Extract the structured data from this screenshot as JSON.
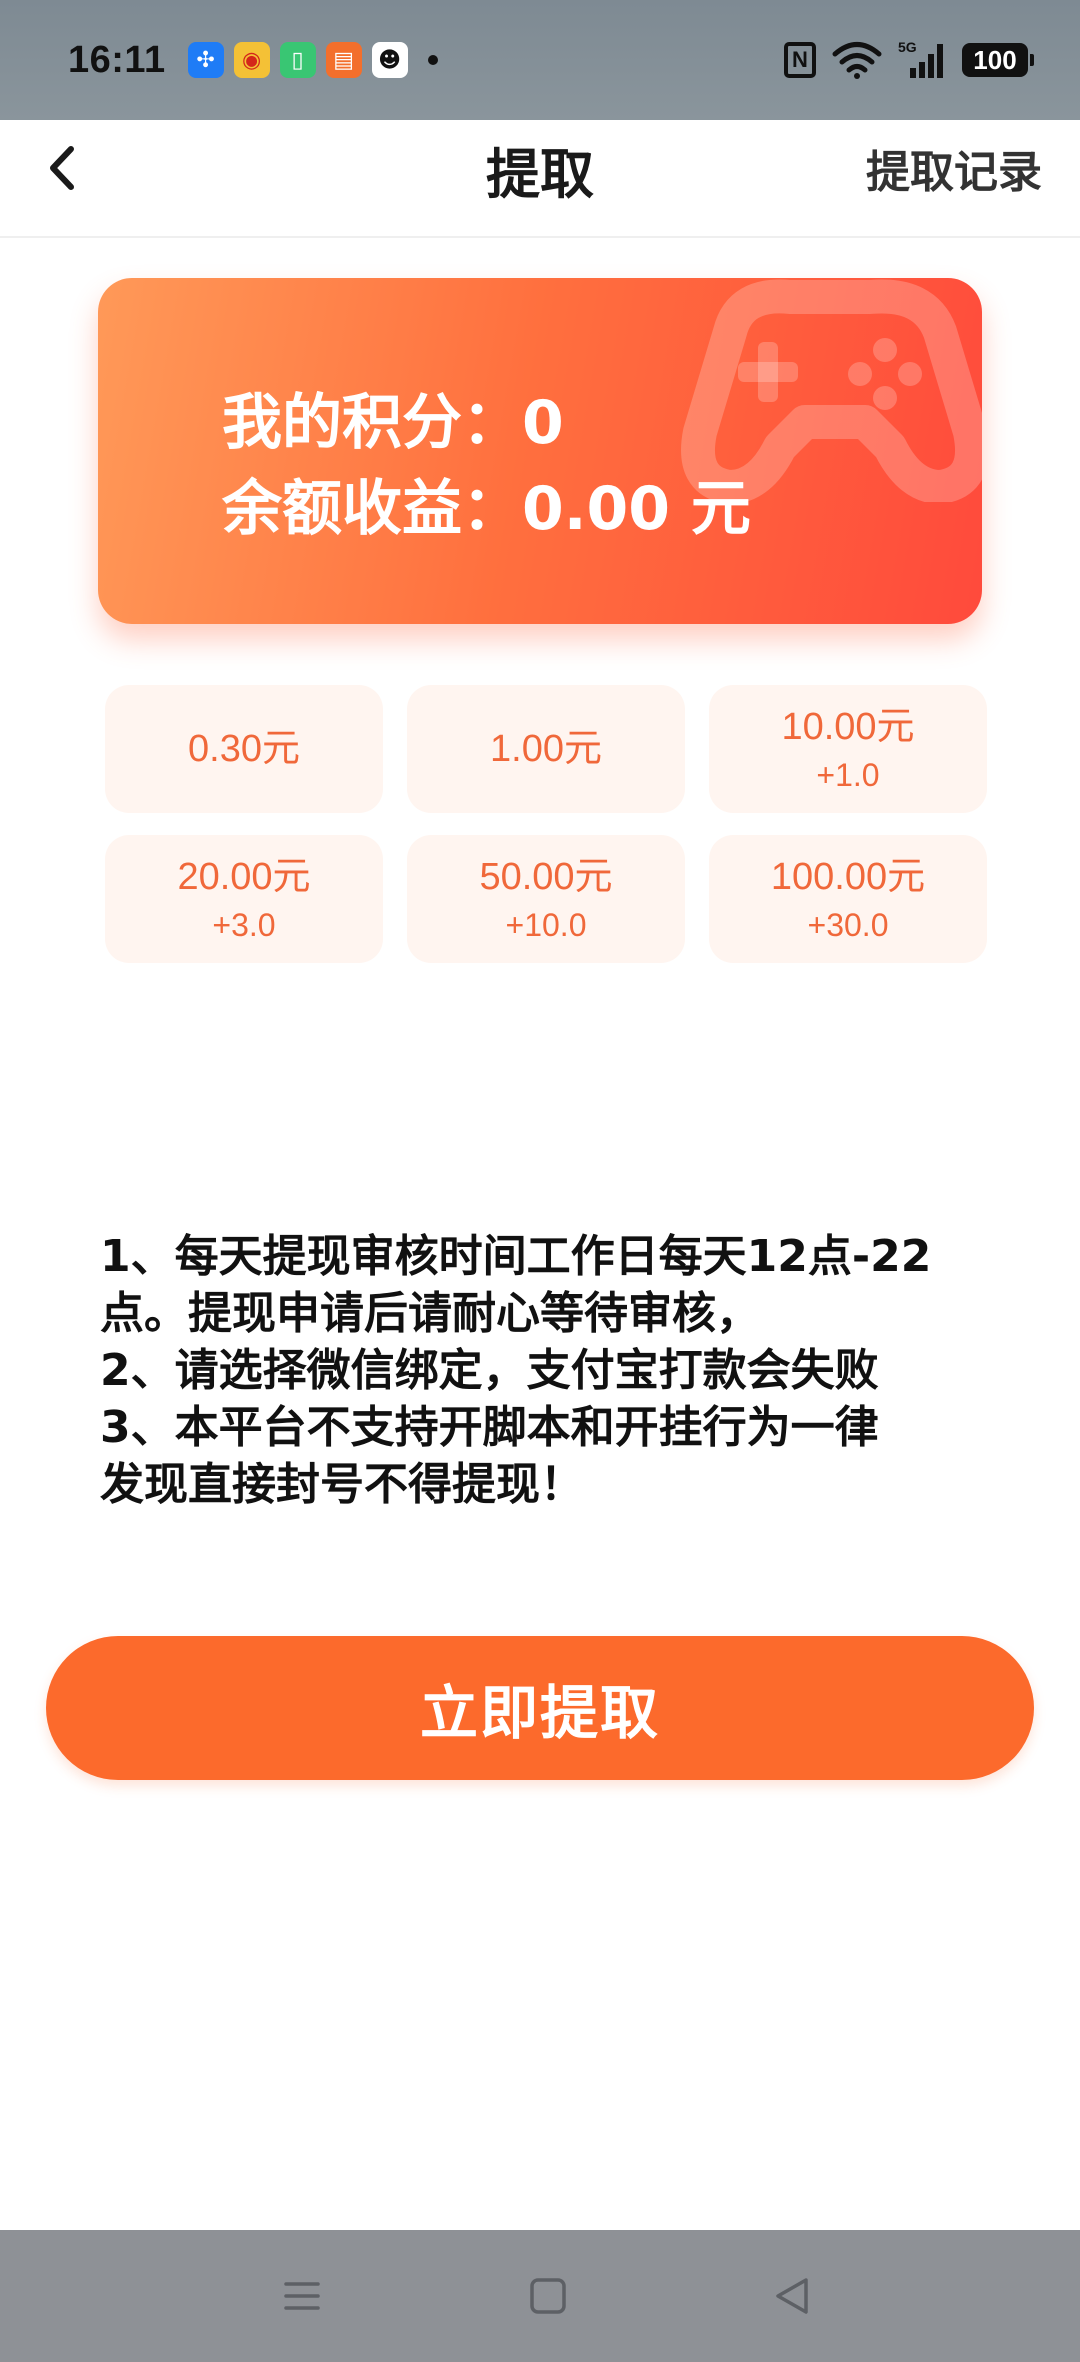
{
  "status_bar": {
    "time": "16:11",
    "notification_icons": [
      "pinwheel-app-icon",
      "weibo-app-icon",
      "battery-app-icon",
      "reader-app-icon",
      "qq-app-icon"
    ],
    "network": "5G",
    "battery": "100"
  },
  "header": {
    "title": "提取",
    "history_link": "提取记录"
  },
  "balance_card": {
    "points_line": "我的积分：0",
    "balance_line": "余额收益：0.00 元"
  },
  "amount_options": [
    {
      "value": "0.30元",
      "bonus": ""
    },
    {
      "value": "1.00元",
      "bonus": ""
    },
    {
      "value": "10.00元",
      "bonus": "+1.0"
    },
    {
      "value": "20.00元",
      "bonus": "+3.0"
    },
    {
      "value": "50.00元",
      "bonus": "+10.0"
    },
    {
      "value": "100.00元",
      "bonus": "+30.0"
    }
  ],
  "rules": [
    "1、每天提现审核时间工作日每天12点-22",
    "点。提现申请后请耐心等待审核，",
    "2、请选择微信绑定，支付宝打款会失败",
    "3、本平台不支持开脚本和开挂行为一律",
    "发现直接封号不得提现！"
  ],
  "withdraw_button": "立即提取",
  "colors": {
    "accent": "#fc6a2c",
    "card_gradient_start": "#ff9958",
    "card_gradient_end": "#ff4a3c",
    "option_bg": "#fff5f0",
    "option_text": "#f0683a"
  }
}
